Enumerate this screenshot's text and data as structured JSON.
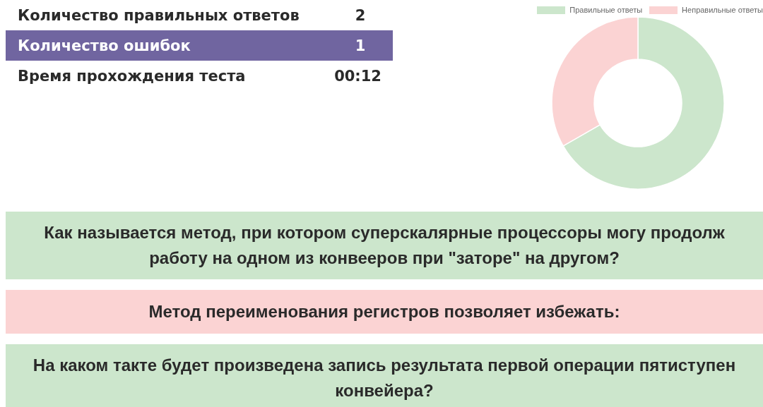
{
  "stats": [
    {
      "label": "Количество правильных ответов",
      "value": "2",
      "selected": false
    },
    {
      "label": "Количество ошибок",
      "value": "1",
      "selected": true
    },
    {
      "label": "Время прохождения теста",
      "value": "00:12",
      "selected": false
    }
  ],
  "chart": {
    "chart_data": {
      "type": "donut",
      "categories": [
        "Правильные ответы",
        "Неправильные ответы"
      ],
      "values": [
        66.7,
        33.3
      ],
      "legend": "top",
      "colors": [
        "#cce6cc",
        "#fbd3d3"
      ]
    }
  },
  "questions": [
    {
      "lines": [
        "Как называется метод, при котором суперскалярные процессоры могу продолж",
        "работу на одном из конвееров при \"заторе\" на другом?"
      ],
      "correct": true
    },
    {
      "lines": [
        "Метод переименования регистров позволяет избежать:"
      ],
      "correct": false
    },
    {
      "lines": [
        "На каком такте будет произведена запись результата первой операции пятиступен",
        "конвейера?"
      ],
      "correct": true
    }
  ]
}
